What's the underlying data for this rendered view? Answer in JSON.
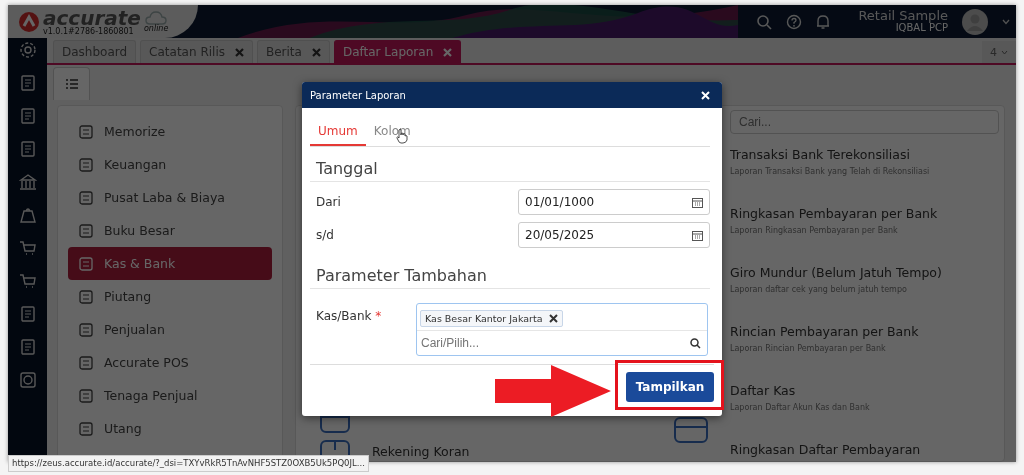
{
  "header": {
    "logo_text": "accurate",
    "logo_sub": "online",
    "version": "v1.0.1#2786-1860801",
    "company": "Retail Sample",
    "user": "IQBAL PCP"
  },
  "tabs": [
    {
      "label": "Dashboard",
      "closable": false,
      "selected": false
    },
    {
      "label": "Catatan Rilis",
      "closable": true,
      "selected": false
    },
    {
      "label": "Berita",
      "closable": true,
      "selected": false
    },
    {
      "label": "Daftar Laporan",
      "closable": true,
      "selected": true
    }
  ],
  "tab_count": "4",
  "menu": [
    {
      "label": "Memorize",
      "selected": false
    },
    {
      "label": "Keuangan",
      "selected": false
    },
    {
      "label": "Pusat Laba & Biaya",
      "selected": false
    },
    {
      "label": "Buku Besar",
      "selected": false
    },
    {
      "label": "Kas & Bank",
      "selected": true
    },
    {
      "label": "Piutang",
      "selected": false
    },
    {
      "label": "Penjualan",
      "selected": false
    },
    {
      "label": "Accurate POS",
      "selected": false
    },
    {
      "label": "Tenaga Penjual",
      "selected": false
    },
    {
      "label": "Utang",
      "selected": false
    }
  ],
  "report_search": {
    "placeholder": "Cari..."
  },
  "reports_left": [
    {
      "title": "Rekening Koran"
    }
  ],
  "reports": [
    {
      "title": "Transaksi Bank Terekonsiliasi",
      "description": "Laporan Transaksi Bank yang Telah di Rekonsiliasi"
    },
    {
      "title": "Ringkasan Pembayaran per Bank",
      "description": "Laporan Ringkasan Pembayaran per Bank"
    },
    {
      "title": "Giro Mundur (Belum Jatuh Tempo)",
      "description": "Laporan daftar cek yang belum jatuh tempo"
    },
    {
      "title": "Rincian Pembayaran per Bank",
      "description": "Laporan Rincian Pembayaran per Bank"
    },
    {
      "title": "Daftar Kas",
      "description": "Laporan Daftar Akun Kas dan Bank"
    },
    {
      "title": "Ringkasan Daftar Pembayaran"
    }
  ],
  "status_url": "https://zeus.accurate.id/accurate/?_dsi=TXYvRkR5TnAvNHF5STZ0OXB5Uk5PQ0JL...",
  "dialog": {
    "title": "Parameter Laporan",
    "tabs": [
      {
        "label": "Umum",
        "selected": true
      },
      {
        "label": "Kolom",
        "selected": false
      }
    ],
    "date_heading": "Tanggal",
    "dates": [
      {
        "label": "Dari",
        "value": "01/01/1000"
      },
      {
        "label": "s/d",
        "value": "20/05/2025"
      }
    ],
    "extra_heading": "Parameter Tambahan",
    "account": {
      "label": "Kas/Bank",
      "required_mark": "*",
      "tags": [
        "Kas Besar Kantor Jakarta"
      ],
      "placeholder": "Cari/Pilih..."
    },
    "submit": "Tampilkan"
  }
}
